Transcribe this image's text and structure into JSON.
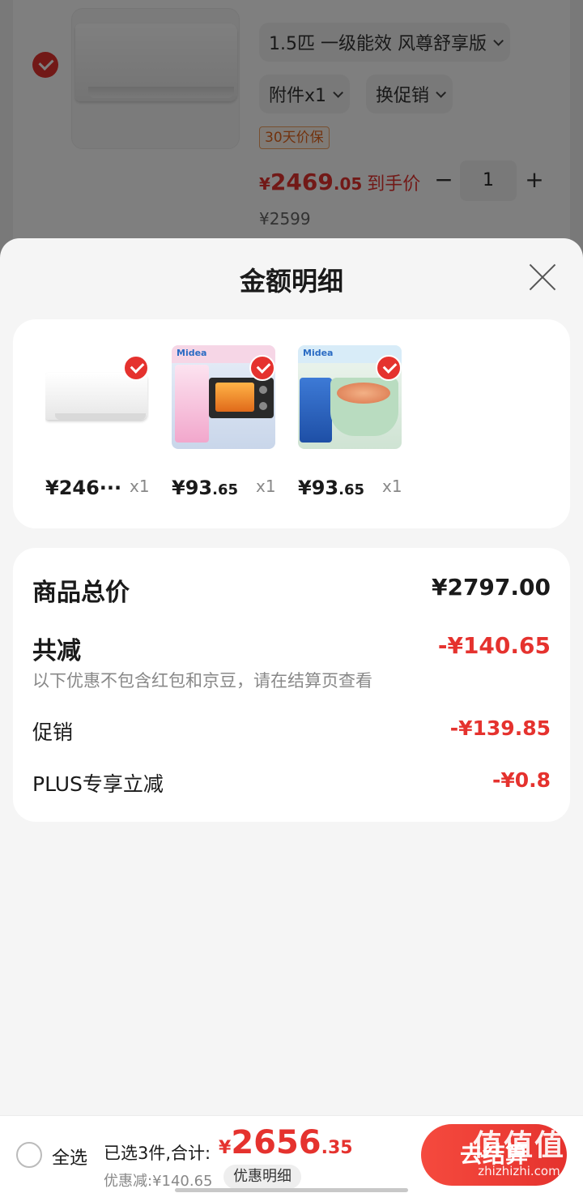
{
  "background_item": {
    "spec_chip": "1.5匹 一级能效 风尊舒享版",
    "accessory_chip": "附件x1",
    "promo_chip": "换促销",
    "tag": "30天价保",
    "price_yen": "¥",
    "price_int": "2469",
    "price_dec": ".05",
    "price_suffix": "到手价",
    "original_price": "¥2599",
    "qty_minus": "−",
    "quantity": "1",
    "qty_plus": "+"
  },
  "sheet": {
    "title": "金额明细",
    "products": [
      {
        "name": "air-conditioner",
        "price": "¥246···",
        "price_dec": "",
        "qty": "x1"
      },
      {
        "name": "electric-oven",
        "price": "¥93",
        "price_dec": ".65",
        "qty": "x1",
        "logo": "Midea"
      },
      {
        "name": "electric-cooker",
        "price": "¥93",
        "price_dec": ".65",
        "qty": "x1",
        "logo": "Midea"
      }
    ],
    "summary": {
      "total_label": "商品总价",
      "total_value": "¥2797.00",
      "reduce_label": "共减",
      "reduce_value": "-¥140.65",
      "note": "以下优惠不包含红包和京豆，请在结算页查看",
      "promo_label": "促销",
      "promo_value": "-¥139.85",
      "plus_label": "PLUS专享立减",
      "plus_value": "-¥0.8"
    }
  },
  "bottom_bar": {
    "select_all": "全选",
    "selected_text": "已选3件,合计:",
    "total_yen": "¥",
    "total_int": "2656",
    "total_dec": ".35",
    "discount_text": "优惠减:¥140.65",
    "detail_button": "优惠明细",
    "checkout_button": "去结算"
  },
  "watermark": {
    "big": "值值值",
    "small": "zhizhizhi.com"
  },
  "colors": {
    "accent": "#e5322e",
    "sheet_bg": "#f5f5f5",
    "card_bg": "#ffffff"
  }
}
